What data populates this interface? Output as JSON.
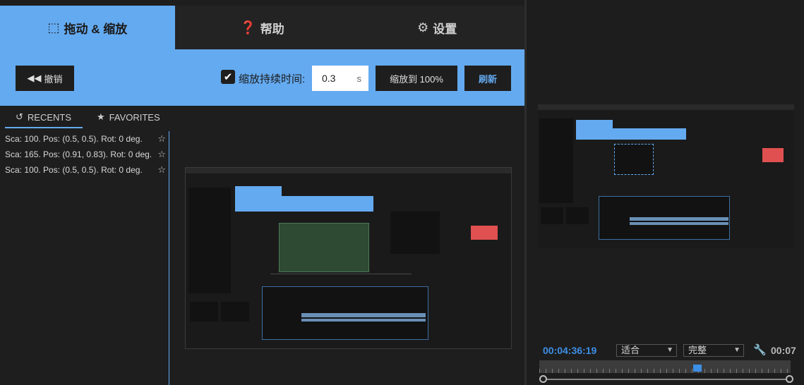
{
  "tabs": [
    {
      "label": "拖动 & 缩放",
      "icon": "drag-select-icon"
    },
    {
      "label": "帮助",
      "icon": "help-icon"
    },
    {
      "label": "设置",
      "icon": "gear-icon"
    }
  ],
  "toolbar": {
    "undo_label": "撤销",
    "duration_checked": true,
    "duration_label": "缩放持续时间:",
    "duration_value": "0.3",
    "duration_unit": "s",
    "zoom100_label": "缩放到 100%",
    "refresh_label": "刷新"
  },
  "history": {
    "recents_label": "RECENTS",
    "favorites_label": "FAVORITES",
    "items": [
      "Sca: 100. Pos: (0.5, 0.5). Rot: 0 deg.",
      "Sca: 165. Pos: (0.91, 0.83). Rot: 0 deg.",
      "Sca: 100. Pos: (0.5, 0.5). Rot: 0 deg."
    ]
  },
  "monitor": {
    "timecode": "00:04:36:19",
    "fit_label": "适合",
    "quality_label": "完整",
    "timecode_right": "00:07"
  },
  "colors": {
    "accent": "#64aaf0",
    "timecode_blue": "#3d8fe6",
    "panel_bg": "#1e1e1e"
  }
}
